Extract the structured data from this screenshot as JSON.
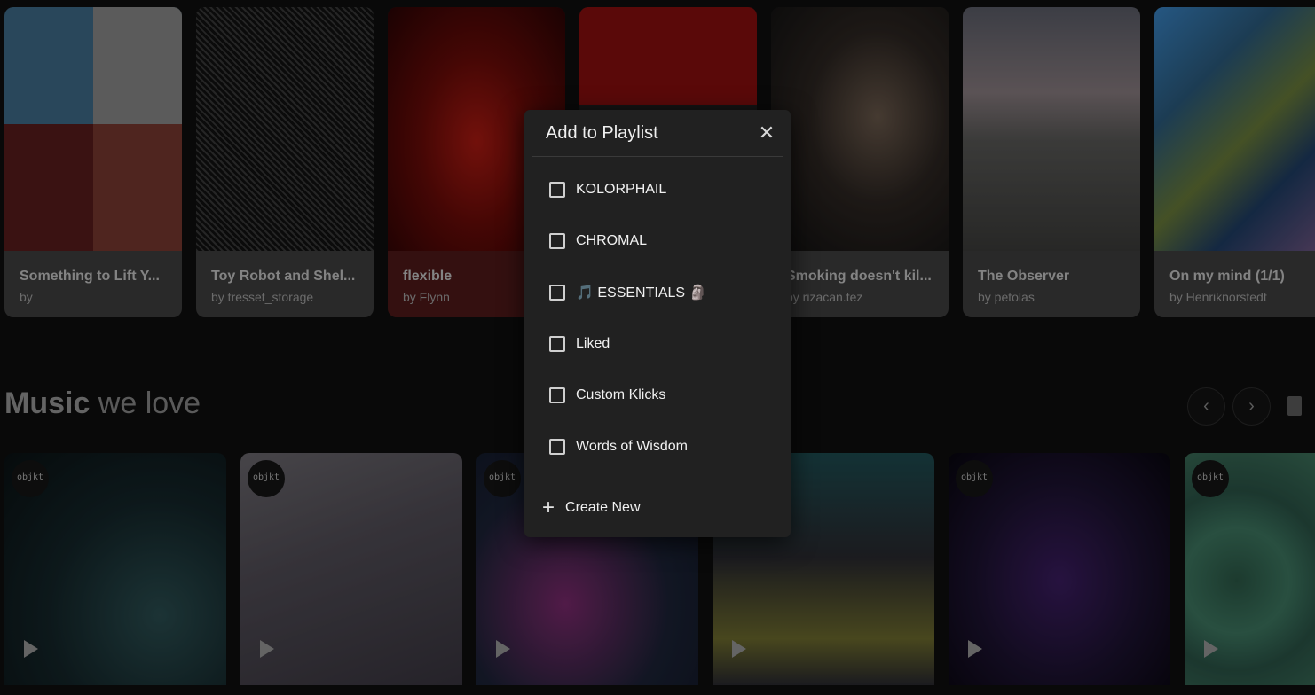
{
  "featured": {
    "cards": [
      {
        "title": "Something to Lift Y...",
        "author": "by"
      },
      {
        "title": "Toy Robot and Shel...",
        "author": "by tresset_storage"
      },
      {
        "title": "flexible",
        "author": "by Flynn"
      },
      {
        "title": "",
        "author": ""
      },
      {
        "title": "Smoking doesn't kil...",
        "author": "by rizacan.tez"
      },
      {
        "title": "The Observer",
        "author": "by petolas"
      },
      {
        "title": "On my mind (1/1)",
        "author": "by Henriknorstedt"
      }
    ]
  },
  "music_section": {
    "title_bold": "Music",
    "title_rest": " we love",
    "prev_icon": "‹",
    "next_icon": "›",
    "badge_text": "objkt",
    "cards_count_shown": 6
  },
  "modal": {
    "title": "Add to Playlist",
    "close_icon": "✕",
    "playlists": [
      {
        "label": "KOLORPHAIL",
        "checked": false
      },
      {
        "label": "CHROMAL",
        "checked": false
      },
      {
        "label": "🎵 ESSENTIALS 🗿",
        "checked": false
      },
      {
        "label": "Liked",
        "checked": false
      },
      {
        "label": "Custom Klicks",
        "checked": false
      },
      {
        "label": "Words of Wisdom",
        "checked": false
      }
    ],
    "create_new_icon": "+",
    "create_new_label": "Create New"
  }
}
